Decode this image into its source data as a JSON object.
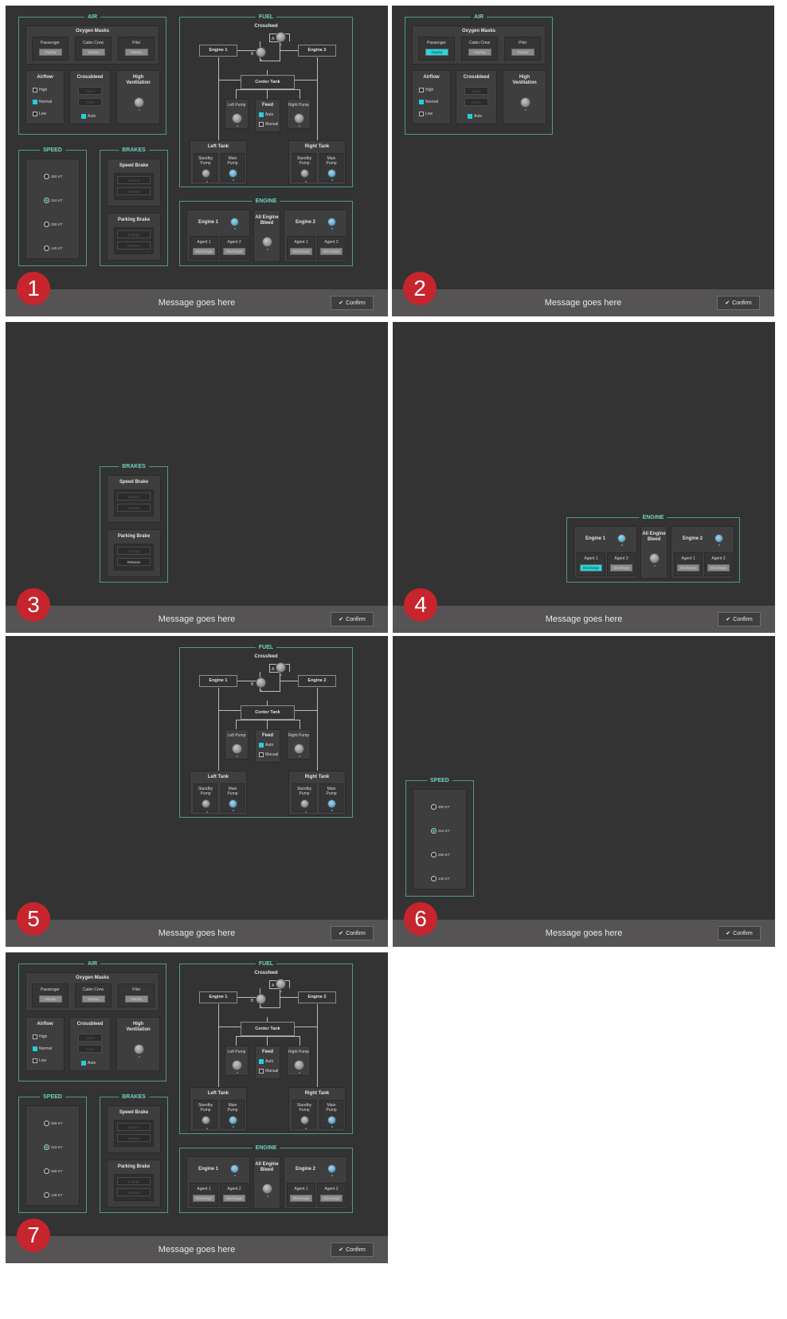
{
  "message": "Message goes here",
  "confirm_label": "Confirm",
  "check_icon": "✔",
  "badges": [
    "1",
    "2",
    "3",
    "4",
    "5",
    "6",
    "7"
  ],
  "air": {
    "title": "AIR",
    "oxygen_masks": "Oxygen Masks",
    "passenger": "Passenger",
    "cabin_crew": "Cabin Crew",
    "pilot": "Pilot",
    "deploy": "Deploy",
    "airflow": "Airflow",
    "high": "High",
    "normal": "Normal",
    "low": "Low",
    "crossbleed": "Crossbleed",
    "open": "Open",
    "close": "Close",
    "auto": "Auto",
    "high_ventilation": "High Ventilation"
  },
  "fuel": {
    "title": "FUEL",
    "crossfeed": "Crossfeed",
    "valve_a": "A",
    "valve_b": "B",
    "engine_1": "Engine 1",
    "engine_2": "Engine 2",
    "center_tank": "Center Tank",
    "left_pump": "Left Pump",
    "right_pump": "Right Pump",
    "feed": "Feed",
    "auto": "Auto",
    "manual": "Manual",
    "left_tank": "Left Tank",
    "right_tank": "Right Tank",
    "standby_pump": "Standby Pump",
    "main_pump": "Main Pump"
  },
  "speed": {
    "title": "SPEED",
    "options": [
      "300 KT",
      "310 KT",
      "250 KT",
      "140 KT"
    ],
    "selected_index": 1
  },
  "brakes": {
    "title": "BRAKES",
    "speed_brake": "Speed Brake",
    "extend": "Extend",
    "retract": "Retract",
    "parking_brake": "Parking Brake",
    "engage": "Engage",
    "release": "Release"
  },
  "engine": {
    "title": "ENGINE",
    "engine_1": "Engine 1",
    "engine_2": "Engine 2",
    "all_engine_bleed": "All Engine Bleed",
    "agent_1": "Agent 1",
    "agent_2": "Agent 2",
    "discharge": "Discharge"
  },
  "colors": {
    "background": "#333333",
    "accent": "#6fd3c0",
    "active_button": "#25d7dd",
    "badge": "#c6252d",
    "message_bar": "#555353"
  }
}
